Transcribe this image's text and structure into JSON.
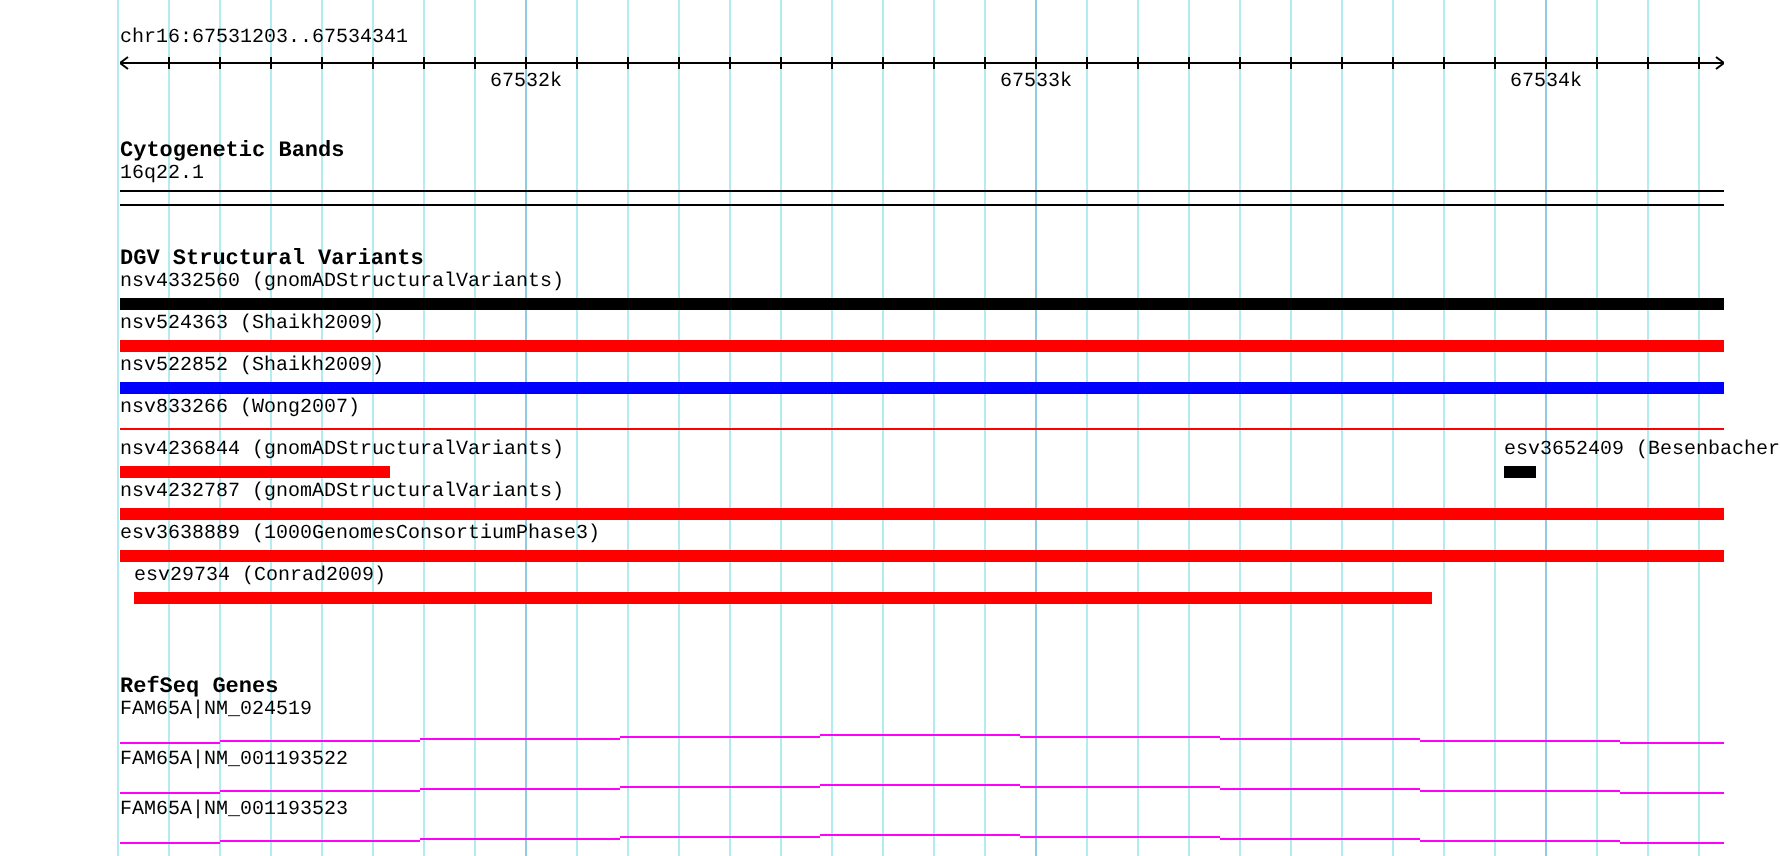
{
  "location": "chr16:67531203..67534341",
  "ruler": {
    "ticks": [
      "67532k",
      "67533k",
      "67534k"
    ]
  },
  "cytogenetic_bands": {
    "title": "Cytogenetic Bands",
    "features": [
      {
        "label": "16q22.1"
      }
    ]
  },
  "dgv_structural_variants": {
    "title": "DGV Structural Variants",
    "rows": [
      {
        "features": [
          {
            "label": "nsv4332560 (gnomADStructuralVariants)",
            "color": "#000000",
            "kind": "bar"
          }
        ]
      },
      {
        "features": [
          {
            "label": "nsv524363 (Shaikh2009)",
            "color": "#ff0000",
            "kind": "bar"
          }
        ]
      },
      {
        "features": [
          {
            "label": "nsv522852 (Shaikh2009)",
            "color": "#0000ff",
            "kind": "bar"
          }
        ]
      },
      {
        "features": [
          {
            "label": "nsv833266 (Wong2007)",
            "color": "#ff0000",
            "kind": "line"
          }
        ]
      },
      {
        "features": [
          {
            "label": "nsv4236844 (gnomADStructuralVariants)",
            "color": "#ff0000",
            "kind": "bar"
          },
          {
            "label": "esv3652409 (Besenbacher",
            "color": "#000000",
            "kind": "bar"
          }
        ]
      },
      {
        "features": [
          {
            "label": "nsv4232787 (gnomADStructuralVariants)",
            "color": "#ff0000",
            "kind": "bar"
          }
        ]
      },
      {
        "features": [
          {
            "label": "esv3638889 (1000GenomesConsortiumPhase3)",
            "color": "#ff0000",
            "kind": "bar"
          }
        ]
      },
      {
        "features": [
          {
            "label": "esv29734 (Conrad2009)",
            "color": "#ff0000",
            "kind": "bar"
          }
        ]
      }
    ]
  },
  "refseq_genes": {
    "title": "RefSeq Genes",
    "features": [
      {
        "label": "FAM65A|NM_024519"
      },
      {
        "label": "FAM65A|NM_001193522"
      },
      {
        "label": "FAM65A|NM_001193523"
      }
    ]
  }
}
